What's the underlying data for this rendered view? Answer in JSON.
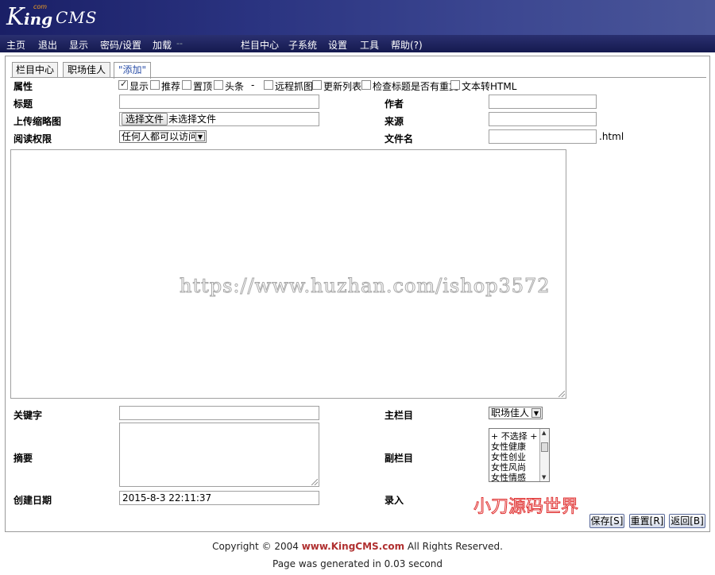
{
  "logo": {
    "k": "K",
    "ing": "ing",
    "cms": "CMS",
    "com": "com"
  },
  "nav": {
    "left": [
      "主页",
      "退出",
      "显示",
      "密码/设置",
      "加载"
    ],
    "sep": "--",
    "right": [
      "栏目中心",
      "子系统",
      "设置",
      "工具",
      "帮助(?)"
    ]
  },
  "tabs": [
    "栏目中心",
    "职场佳人",
    "\"添加\""
  ],
  "form": {
    "attr_label": "属性",
    "checkboxes": [
      {
        "label": "显示",
        "checked": true
      },
      {
        "label": "推荐",
        "checked": false
      },
      {
        "label": "置顶",
        "checked": false
      },
      {
        "label": "头条",
        "checked": false
      },
      {
        "label": "远程抓图",
        "checked": false
      },
      {
        "label": "更新列表",
        "checked": false
      },
      {
        "label": "检查标题是否有重复",
        "checked": false
      },
      {
        "label": "文本转HTML",
        "checked": false
      }
    ],
    "attr_dash": "-",
    "title_label": "标题",
    "author_label": "作者",
    "thumb_label": "上传缩略图",
    "file_button": "选择文件",
    "file_status": "未选择文件",
    "source_label": "来源",
    "perm_label": "阅读权限",
    "perm_value": "任何人都可以访问",
    "filename_label": "文件名",
    "filename_ext": ".html",
    "keywords_label": "关键字",
    "main_col_label": "主栏目",
    "main_col_value": "职场佳人",
    "summary_label": "摘要",
    "sub_col_label": "副栏目",
    "sub_col_options": [
      "+ 不选择 +",
      "女性健康",
      "女性创业",
      "女性风尚",
      "女性情感"
    ],
    "date_label": "创建日期",
    "date_value": "2015-8-3 22:11:37",
    "entry_label": "录入"
  },
  "watermark": "https://www.huzhan.com/ishop3572",
  "stamp": "小刀源码世界",
  "buttons": {
    "save": "保存[S]",
    "reset": "重置[R]",
    "back": "返回[B]"
  },
  "footer": {
    "copyright_pre": "Copyright © 2004 ",
    "brand": "www.KingCMS.com",
    "copyright_post": " All Rights Reserved.",
    "generated": "Page was generated in 0.03 second"
  },
  "colors": {
    "header": "#2a3380",
    "nav": "#1c2158",
    "tab_active_text": "#2b4fa8",
    "footer_brand": "#b03030",
    "stamp": "#e03030"
  }
}
